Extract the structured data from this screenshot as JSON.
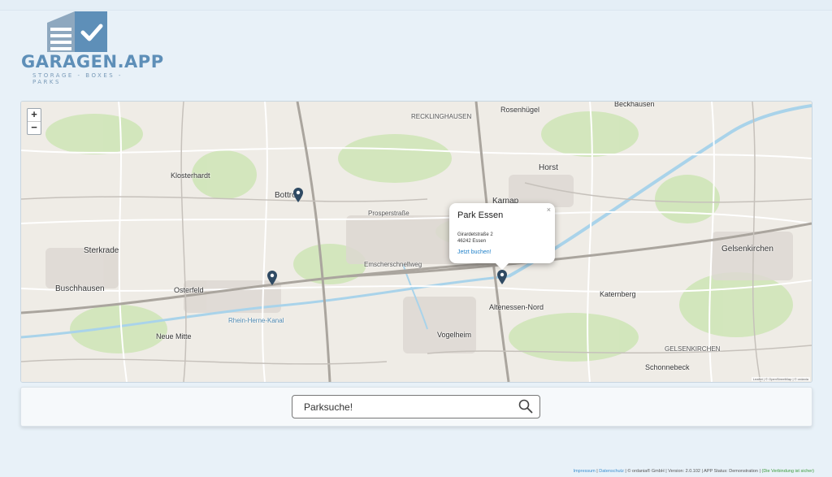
{
  "logo": {
    "brand": "GARAGEN.APP",
    "tagline": "STORAGE - BOXES - PARKS"
  },
  "map": {
    "zoom_in": "+",
    "zoom_out": "−",
    "labels": {
      "recklinghausen": "RECKLINGHAUSEN",
      "beckhausen": "Beckhausen",
      "rosenhuegel": "Rosenhügel",
      "klosterhardt": "Klosterhardt",
      "bottrop": "Bottrop",
      "horst": "Horst",
      "karnap": "Karnap",
      "sterkrade": "Sterkrade",
      "gelsenkirchen": "Gelsenkirchen",
      "buschhausen": "Buschhausen",
      "osterfeld": "Osterfeld",
      "katernberg": "Katernberg",
      "altenessen_nord": "Altenessen-Nord",
      "vogelheim": "Vogelheim",
      "neue_mitte": "Neue Mitte",
      "schonnebeck": "Schonnebeck",
      "prosperstrasse": "Prosperstraße",
      "emscherschnellweg": "Emscherschnellweg",
      "rhein_herne_kanal": "Rhein-Herne-Kanal",
      "gelsenkirchen_district": "GELSENKIRCHEN"
    },
    "attribution": "Leaflet | © OpenStreetMap | © ordania"
  },
  "popup": {
    "title": "Park Essen",
    "street": "Girardetstraße 2",
    "city": "46242 Essen",
    "link": "Jetzt buchen!",
    "close": "×"
  },
  "search": {
    "placeholder": "Parksuche!"
  },
  "footer": {
    "impressum": "Impressum",
    "sep1": " | ",
    "datenschutz": "Datenschutz",
    "info": " | © ordania® GmbH | Version: 2.0.102 | APP Status: Demonstration | ",
    "connection": "(Die Verbindung ist sicher)"
  },
  "colors": {
    "accent": "#5e8fb8",
    "marker": "#2f4a63",
    "water": "#a9d3ea",
    "link": "#1e7fc8"
  }
}
